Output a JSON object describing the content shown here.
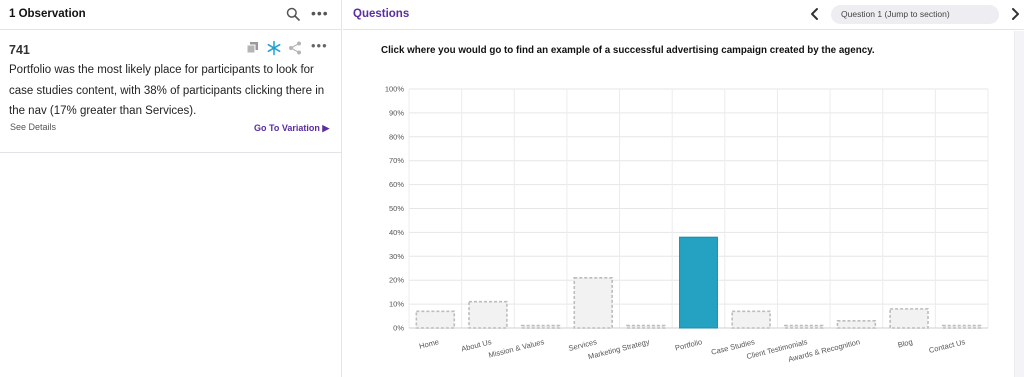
{
  "left": {
    "title": "1 Observation",
    "card": {
      "number": "741",
      "text": "Portfolio was the most likely place for participants to look for case studies content, with 38% of participants clicking there in the nav (17% greater than Services).",
      "see_details": "See Details",
      "go_to_variation": "Go To Variation ▶"
    }
  },
  "right": {
    "title": "Questions",
    "question_pill": "Question 1 (Jump to section)",
    "question_text": "Click where you would go to find an example of a successful advertising campaign created by the agency."
  },
  "colors": {
    "accent": "#5a2da0",
    "highlight_bar": "#25a2c2",
    "bar_fill": "#f2f2f2",
    "bar_border": "#bdbdbd",
    "snowflake": "#1e9fd6"
  },
  "icons": [
    "search-icon",
    "more-icon",
    "copy-icon",
    "snowflake-icon",
    "share-icon",
    "chevron-left-icon",
    "chevron-right-icon"
  ],
  "chart_data": {
    "type": "bar",
    "categories": [
      "Home",
      "About Us",
      "Mission & Values",
      "Services",
      "Marketing Strategy",
      "Portfolio",
      "Case Studies",
      "Client Testimonials",
      "Awards & Recognition",
      "Blog",
      "Contact Us"
    ],
    "values": [
      7,
      11,
      1,
      21,
      1,
      38,
      7,
      1,
      3,
      8,
      1
    ],
    "highlight_index": 5,
    "ylim": [
      0,
      100
    ],
    "yticks": [
      "0%",
      "10%",
      "20%",
      "30%",
      "40%",
      "50%",
      "60%",
      "70%",
      "80%",
      "90%",
      "100%"
    ],
    "grid": true
  }
}
